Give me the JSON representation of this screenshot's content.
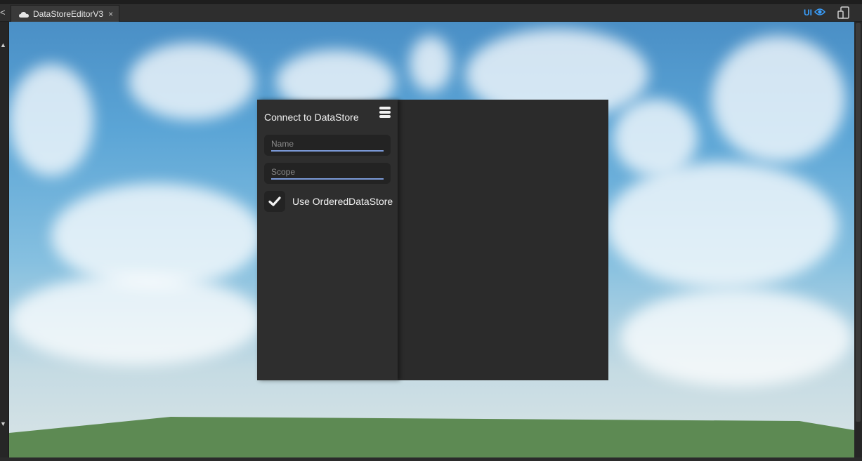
{
  "tabbar": {
    "tab": {
      "title": "DataStoreEditorV3",
      "icon": "cloud-icon",
      "close_icon": "close-icon",
      "close_label": "×"
    },
    "ui_toggle": {
      "label": "UI",
      "icon": "eye-icon",
      "color": "#3aa0ff"
    },
    "device_icon": "device-emulator-icon",
    "left_collapse": "<"
  },
  "plugin": {
    "title": "Connect to DataStore",
    "menu_icon": "hamburger-menu-icon",
    "name_field": {
      "placeholder": "Name",
      "value": ""
    },
    "scope_field": {
      "placeholder": "Scope",
      "value": ""
    },
    "ordered_checkbox": {
      "label": "Use OrderedDataStore",
      "checked": true,
      "icon": "checkmark-icon"
    },
    "colors": {
      "panel_bg": "#2e2e2e",
      "field_bg": "#232323",
      "underline": "#7b9ad8",
      "text": "#f2f2f2"
    }
  },
  "viewport": {
    "sky_color": "#5ba5d6",
    "ground_color": "#5d8a53"
  }
}
